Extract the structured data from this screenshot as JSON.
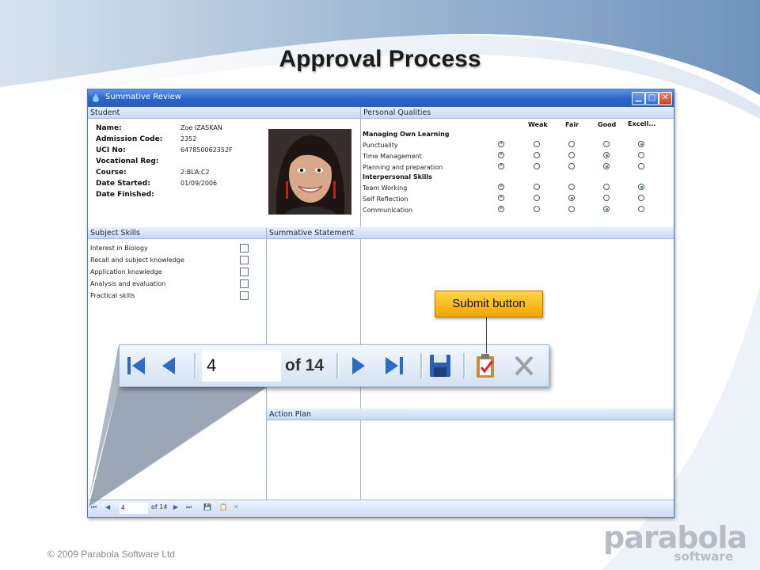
{
  "slide": {
    "title": "Approval Process",
    "footer": "© 2009 Parabola Software Ltd",
    "logo": {
      "word": "parabola",
      "sub": "software"
    }
  },
  "window": {
    "title": "Summative Review",
    "controls": [
      "minimize-icon",
      "maximize-icon",
      "close-icon"
    ]
  },
  "student": {
    "header": "Student",
    "fields": [
      {
        "label": "Name:",
        "value": "Zoe IZASKAN"
      },
      {
        "label": "Admission Code:",
        "value": "2352"
      },
      {
        "label": "UCI No:",
        "value": "647850062352F"
      },
      {
        "label": "Vocational Reg:",
        "value": ""
      },
      {
        "label": "Course:",
        "value": "2:BLA:C2"
      },
      {
        "label": "Date Started:",
        "value": "01/09/2006"
      },
      {
        "label": "Date Finished:",
        "value": ""
      }
    ]
  },
  "qualities": {
    "header": "Personal Qualities",
    "columns": [
      "Weak",
      "Fair",
      "Good",
      "Excell..."
    ],
    "groups": [
      {
        "title": "Managing Own Learning",
        "items": [
          {
            "name": "Punctuality",
            "selected": 4
          },
          {
            "name": "Time Management",
            "selected": 3
          },
          {
            "name": "Planning and preparation",
            "selected": 3
          }
        ]
      },
      {
        "title": "Interpersonal Skills",
        "items": [
          {
            "name": "Team Working",
            "selected": 4
          },
          {
            "name": "Self Reflection",
            "selected": 2
          },
          {
            "name": "Communication",
            "selected": 3
          }
        ]
      }
    ]
  },
  "subject_skills": {
    "header": "Subject Skills",
    "items": [
      "Interest in Biology",
      "Recall and subject knowledge",
      "Application knowledge",
      "Analysis and evaluation",
      "Practical skills"
    ]
  },
  "summative_statement": {
    "header": "Summative Statement"
  },
  "action_plan": {
    "header": "Action Plan"
  },
  "navigator": {
    "page": "4",
    "of_label": "of 14"
  },
  "callout": {
    "text": "Submit button"
  },
  "colors": {
    "accent": "#2c63c8",
    "callout": "#f4a400",
    "selected_radio": "#2e9a3c"
  }
}
